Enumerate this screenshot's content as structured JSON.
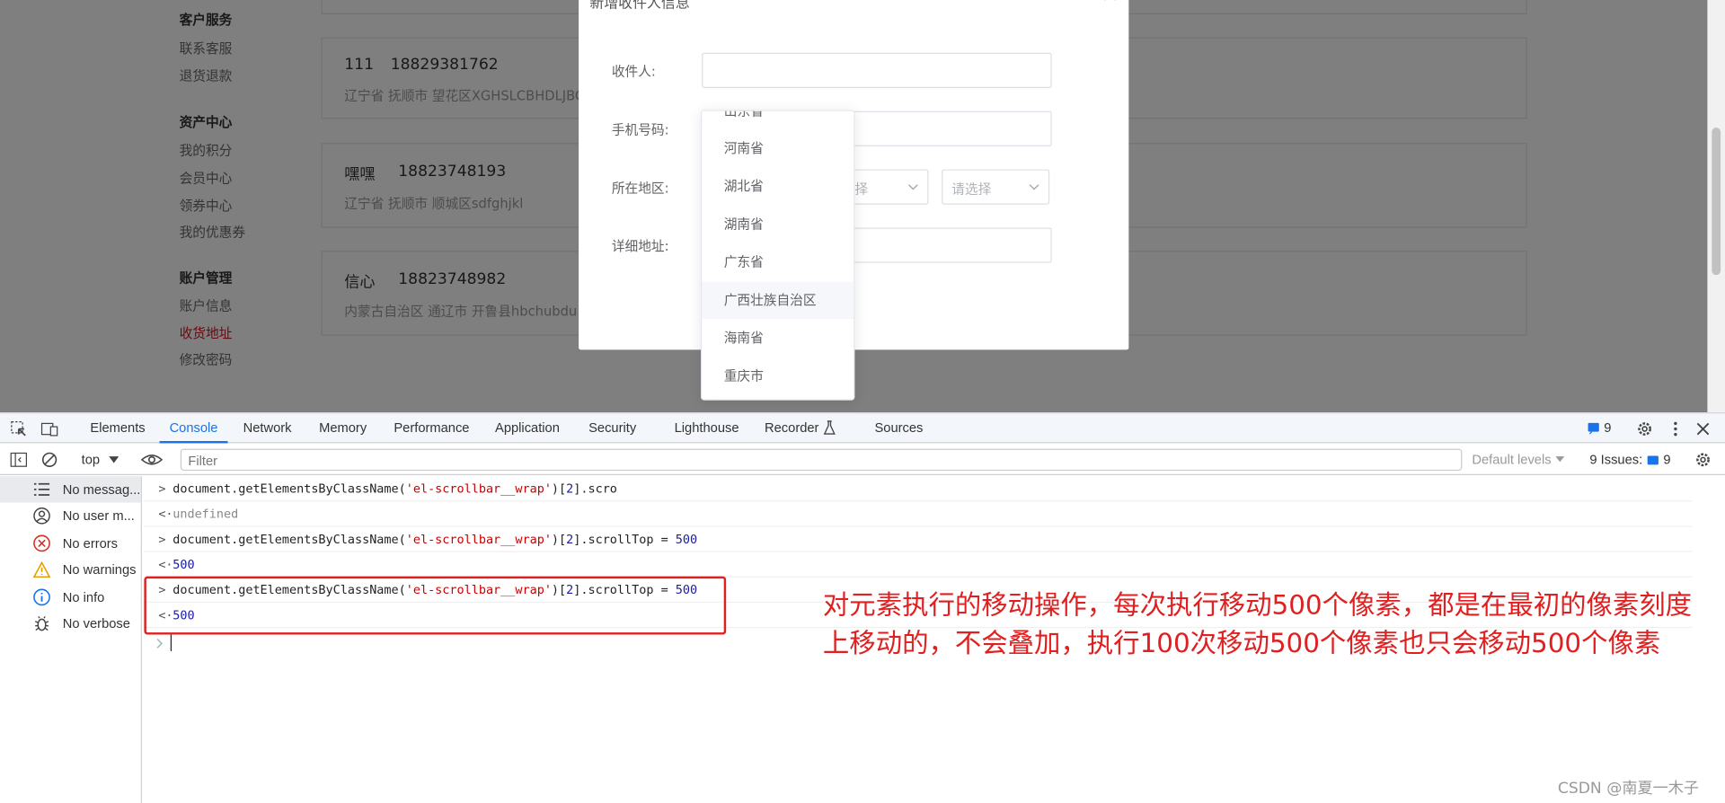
{
  "sidebar": {
    "groups": [
      {
        "title": "客户服务",
        "items": [
          "联系客服",
          "退货退款"
        ]
      },
      {
        "title": "资产中心",
        "items": [
          "我的积分",
          "会员中心",
          "领券中心",
          "我的优惠券"
        ]
      },
      {
        "title": "账户管理",
        "items": [
          "账户信息",
          "收货地址",
          "修改密码"
        ]
      }
    ],
    "active_item": "收货地址"
  },
  "addresses": [
    {
      "name": "111",
      "phone": "18829381762",
      "detail": "辽宁省 抚顺市 望花区XGHSLCBHDLJBC"
    },
    {
      "name": "嘿嘿",
      "phone": "18823748193",
      "detail": "辽宁省 抚顺市 顺城区sdfghjkl"
    },
    {
      "name": "信心",
      "phone": "18823748982",
      "detail": "内蒙古自治区 通辽市 开鲁县hbchubdu"
    }
  ],
  "dialog": {
    "title": "新增收件人信息",
    "fields": {
      "recipient_label": "收件人:",
      "phone_label": "手机号码:",
      "region_label": "所在地区:",
      "address_label": "详细地址:"
    },
    "region_placeholder_1": "择",
    "region_placeholder_2": "请选择"
  },
  "dropdown": {
    "items": [
      "山东省",
      "河南省",
      "湖北省",
      "湖南省",
      "广东省",
      "广西壮族自治区",
      "海南省",
      "重庆市"
    ],
    "hovered": "广西壮族自治区"
  },
  "devtools": {
    "tabs": [
      "Elements",
      "Console",
      "Network",
      "Memory",
      "Performance",
      "Application",
      "Security",
      "Lighthouse",
      "Recorder",
      "Sources"
    ],
    "active_tab": "Console",
    "issues_badge": "9",
    "context": "top",
    "filter_placeholder": "Filter",
    "default_levels": "Default levels",
    "issues_label": "9 Issues:",
    "issues_count": "9",
    "sidebar": [
      {
        "icon": "list-icon",
        "label": "No messag..."
      },
      {
        "icon": "user-icon",
        "label": "No user m..."
      },
      {
        "icon": "error-icon",
        "label": "No errors"
      },
      {
        "icon": "warning-icon",
        "label": "No warnings"
      },
      {
        "icon": "info-icon",
        "label": "No info"
      },
      {
        "icon": "bug-icon",
        "label": "No verbose"
      }
    ],
    "console": [
      {
        "prefix": ">",
        "code_pre": "document.getElementsByClassName(",
        "str": "'el-scrollbar__wrap'",
        "idx_pre": ")[",
        "idx": "2",
        "idx_post": "].scro",
        "num": ""
      },
      {
        "prefix": "<·",
        "result": "undefined",
        "kind": "grey"
      },
      {
        "prefix": ">",
        "code_pre": "document.getElementsByClassName(",
        "str": "'el-scrollbar__wrap'",
        "idx_pre": ")[",
        "idx": "2",
        "idx_post": "].scrollTop = ",
        "num": "500"
      },
      {
        "prefix": "<·",
        "result": "500",
        "kind": "num"
      },
      {
        "prefix": ">",
        "code_pre": "document.getElementsByClassName(",
        "str": "'el-scrollbar__wrap'",
        "idx_pre": ")[",
        "idx": "2",
        "idx_post": "].scrollTop = ",
        "num": "500"
      },
      {
        "prefix": "<·",
        "result": "500",
        "kind": "num"
      }
    ]
  },
  "annotation": "对元素执行的移动操作，每次执行移动500个像素，都是在最初的像素刻度上移动的，不会叠加，执行100次移动500个像素也只会移动500个像素",
  "watermark": "CSDN @南夏一木子",
  "colors": {
    "accent_red": "#c81623",
    "devtools_blue": "#1a73e8",
    "annotation_red": "#e02020"
  }
}
